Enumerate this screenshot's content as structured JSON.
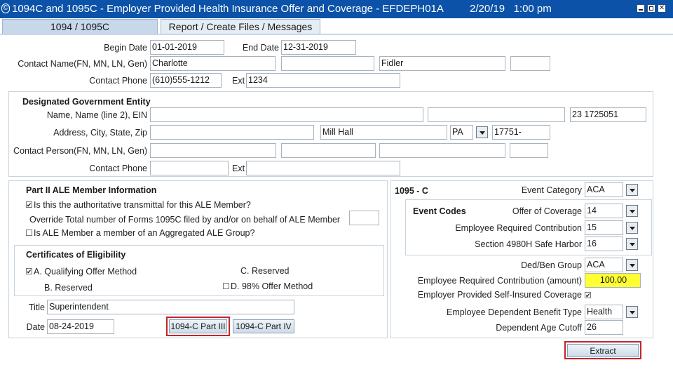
{
  "window": {
    "title": "1094C and 1095C - Employer Provided Health Insurance Offer and Coverage - EFDEPH01A",
    "date": "2/20/19",
    "time": "1:00 pm",
    "icon_glyph": "©",
    "close_glyph": "✕"
  },
  "tabs": [
    "1094 / 1095C",
    "Report / Create Files / Messages"
  ],
  "top": {
    "begin_date_label": "Begin Date",
    "begin_date": "01-01-2019",
    "end_date_label": "End Date",
    "end_date": "12-31-2019",
    "contact_name_label": "Contact Name(FN, MN, LN, Gen)",
    "contact_first": "Charlotte",
    "contact_middle": "",
    "contact_last": "Fidler",
    "contact_gen": "",
    "contact_phone_label": "Contact Phone",
    "contact_phone": "(610)555-1212",
    "ext_label": "Ext",
    "ext": "1234"
  },
  "dge": {
    "heading": "Designated Government Entity",
    "name_label": "Name, Name (line 2), EIN",
    "name": "",
    "name2": "",
    "ein": "23 1725051",
    "address_label": "Address, City, State, Zip",
    "address": "",
    "city": "Mill Hall",
    "state": "PA",
    "zip": "17751-",
    "contact_person_label": "Contact Person(FN, MN, LN, Gen)",
    "cp_first": "",
    "cp_middle": "",
    "cp_last": "",
    "cp_gen": "",
    "contact_phone_label": "Contact Phone",
    "contact_phone": "",
    "ext_label": "Ext",
    "ext": ""
  },
  "part2": {
    "heading": "Part II ALE Member Information",
    "authoritative_label": "Is this the authoritative transmittal for this ALE Member?",
    "authoritative_checked": true,
    "override_label": "Override Total number of Forms 1095C filed by and/or on behalf of ALE Member",
    "override_value": "",
    "aggregated_label": "Is ALE Member a member of an Aggregated ALE Group?",
    "aggregated_checked": false
  },
  "coe": {
    "heading": "Certificates of Eligibility",
    "a_label": "A. Qualifying Offer Method",
    "a_checked": true,
    "b_label": "B. Reserved",
    "c_label": "C. Reserved",
    "d_label": "D. 98% Offer Method",
    "d_checked": false
  },
  "bottom_left": {
    "title_label": "Title",
    "title_value": "Superintendent",
    "date_label": "Date",
    "date_value": "08-24-2019",
    "part3_button": "1094-C Part III",
    "part4_button": "1094-C Part IV"
  },
  "form1095": {
    "heading": "1095 - C",
    "event_category_label": "Event Category",
    "event_category": "ACA",
    "event_codes_heading": "Event Codes",
    "offer_label": "Offer of Coverage",
    "offer": "14",
    "emp_req_contrib_label": "Employee Required Contribution",
    "emp_req_contrib": "15",
    "safe_harbor_label": "Section 4980H Safe Harbor",
    "safe_harbor": "16",
    "ded_ben_label": "Ded/Ben Group",
    "ded_ben": "ACA",
    "amount_label": "Employee Required Contribution (amount)",
    "amount": "100.00",
    "self_insured_label": "Employer Provided Self-Insured Coverage",
    "self_insured_checked": true,
    "dep_benefit_label": "Employee Dependent Benefit Type",
    "dep_benefit": "Health",
    "dep_age_label": "Dependent Age Cutoff",
    "dep_age": "26"
  },
  "extract_button": "Extract",
  "icons": {
    "checkbox_checked": "✔"
  },
  "colors": {
    "titlebar": "#0b52a8",
    "highlight": "#ffff33",
    "callout": "#c0272d"
  }
}
